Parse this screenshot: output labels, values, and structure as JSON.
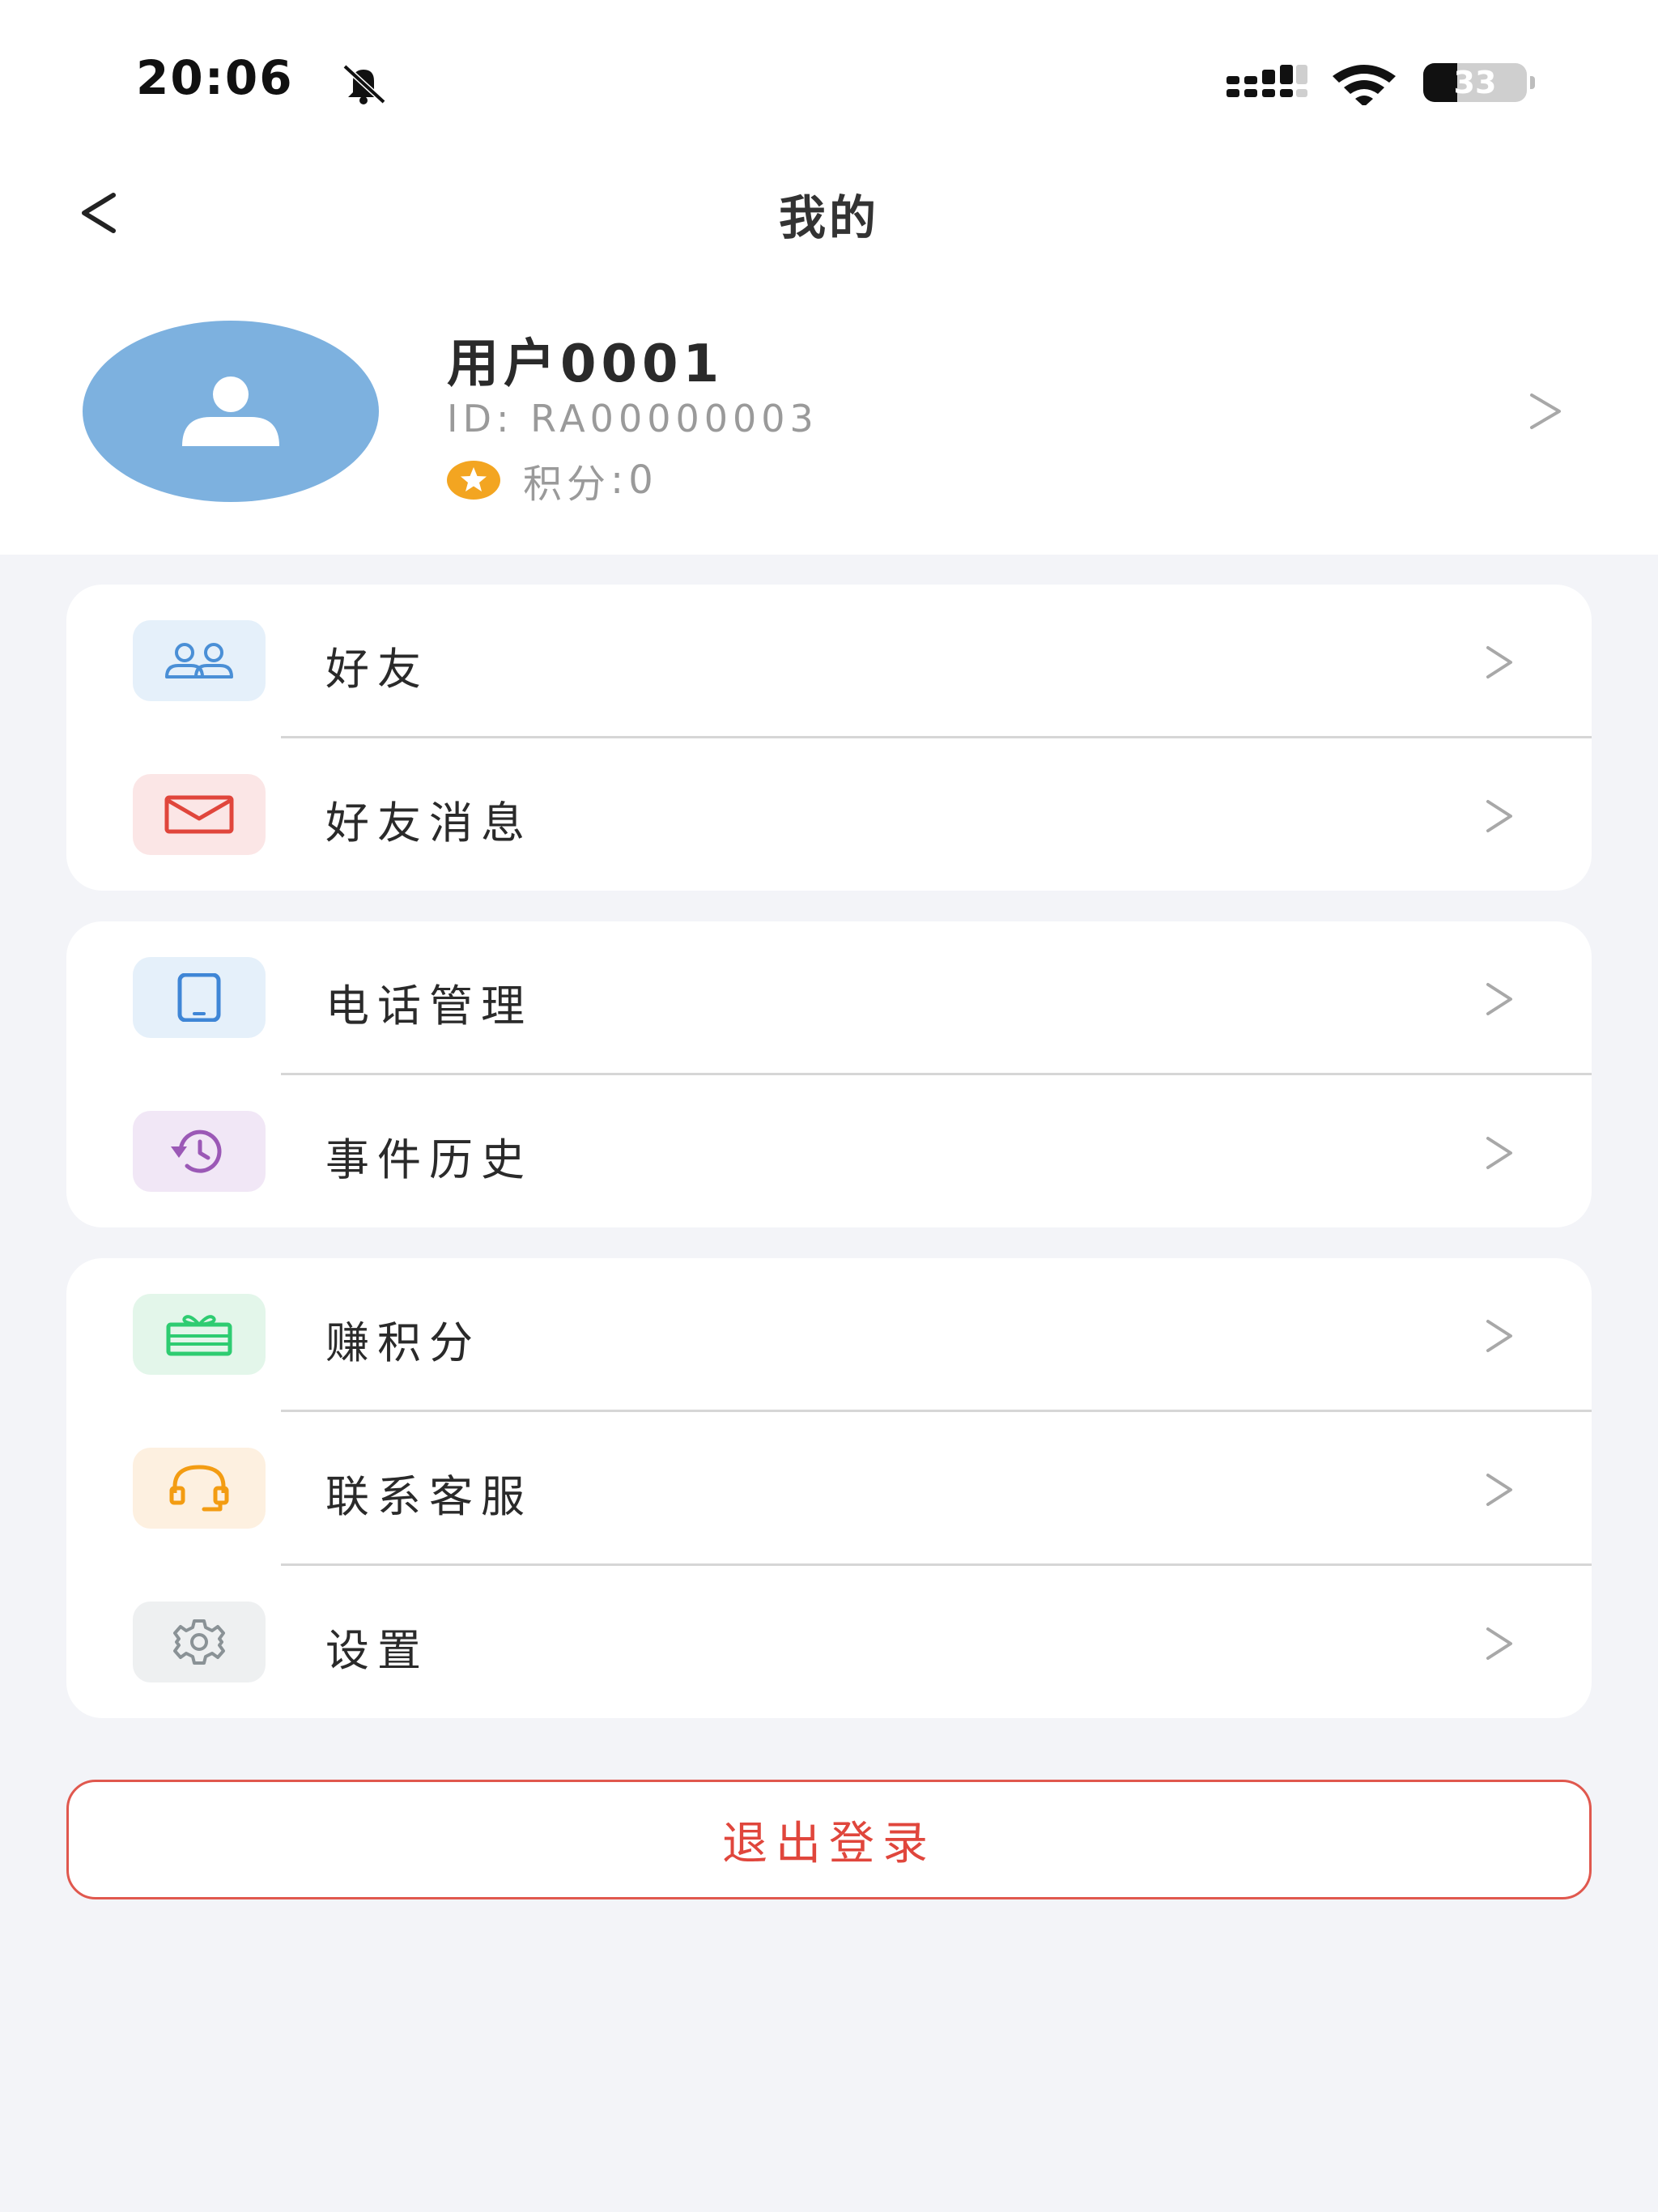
{
  "status_bar": {
    "time": "20:06",
    "battery": "33",
    "battery_level": 0.33
  },
  "nav": {
    "title": "我的"
  },
  "profile": {
    "username": "用户0001",
    "user_id": "ID: RA00000003",
    "points_label": "积分",
    "points_sep": ":",
    "points_value": "0"
  },
  "menu": {
    "friends": "好友",
    "friend_messages": "好友消息",
    "phone_management": "电话管理",
    "event_history": "事件历史",
    "earn_points": "赚积分",
    "contact_support": "联系客服",
    "settings": "设置"
  },
  "logout_label": "退出登录",
  "colors": {
    "avatar": "#7db1df",
    "logout": "#e0463c",
    "friends_icon": "#4a8fd6",
    "messages_icon": "#e0463c",
    "phone_icon": "#3f86d6",
    "history_icon": "#9b59b6",
    "points_icon": "#2ecc71",
    "support_icon": "#f39c12",
    "settings_icon": "#8a9296"
  }
}
